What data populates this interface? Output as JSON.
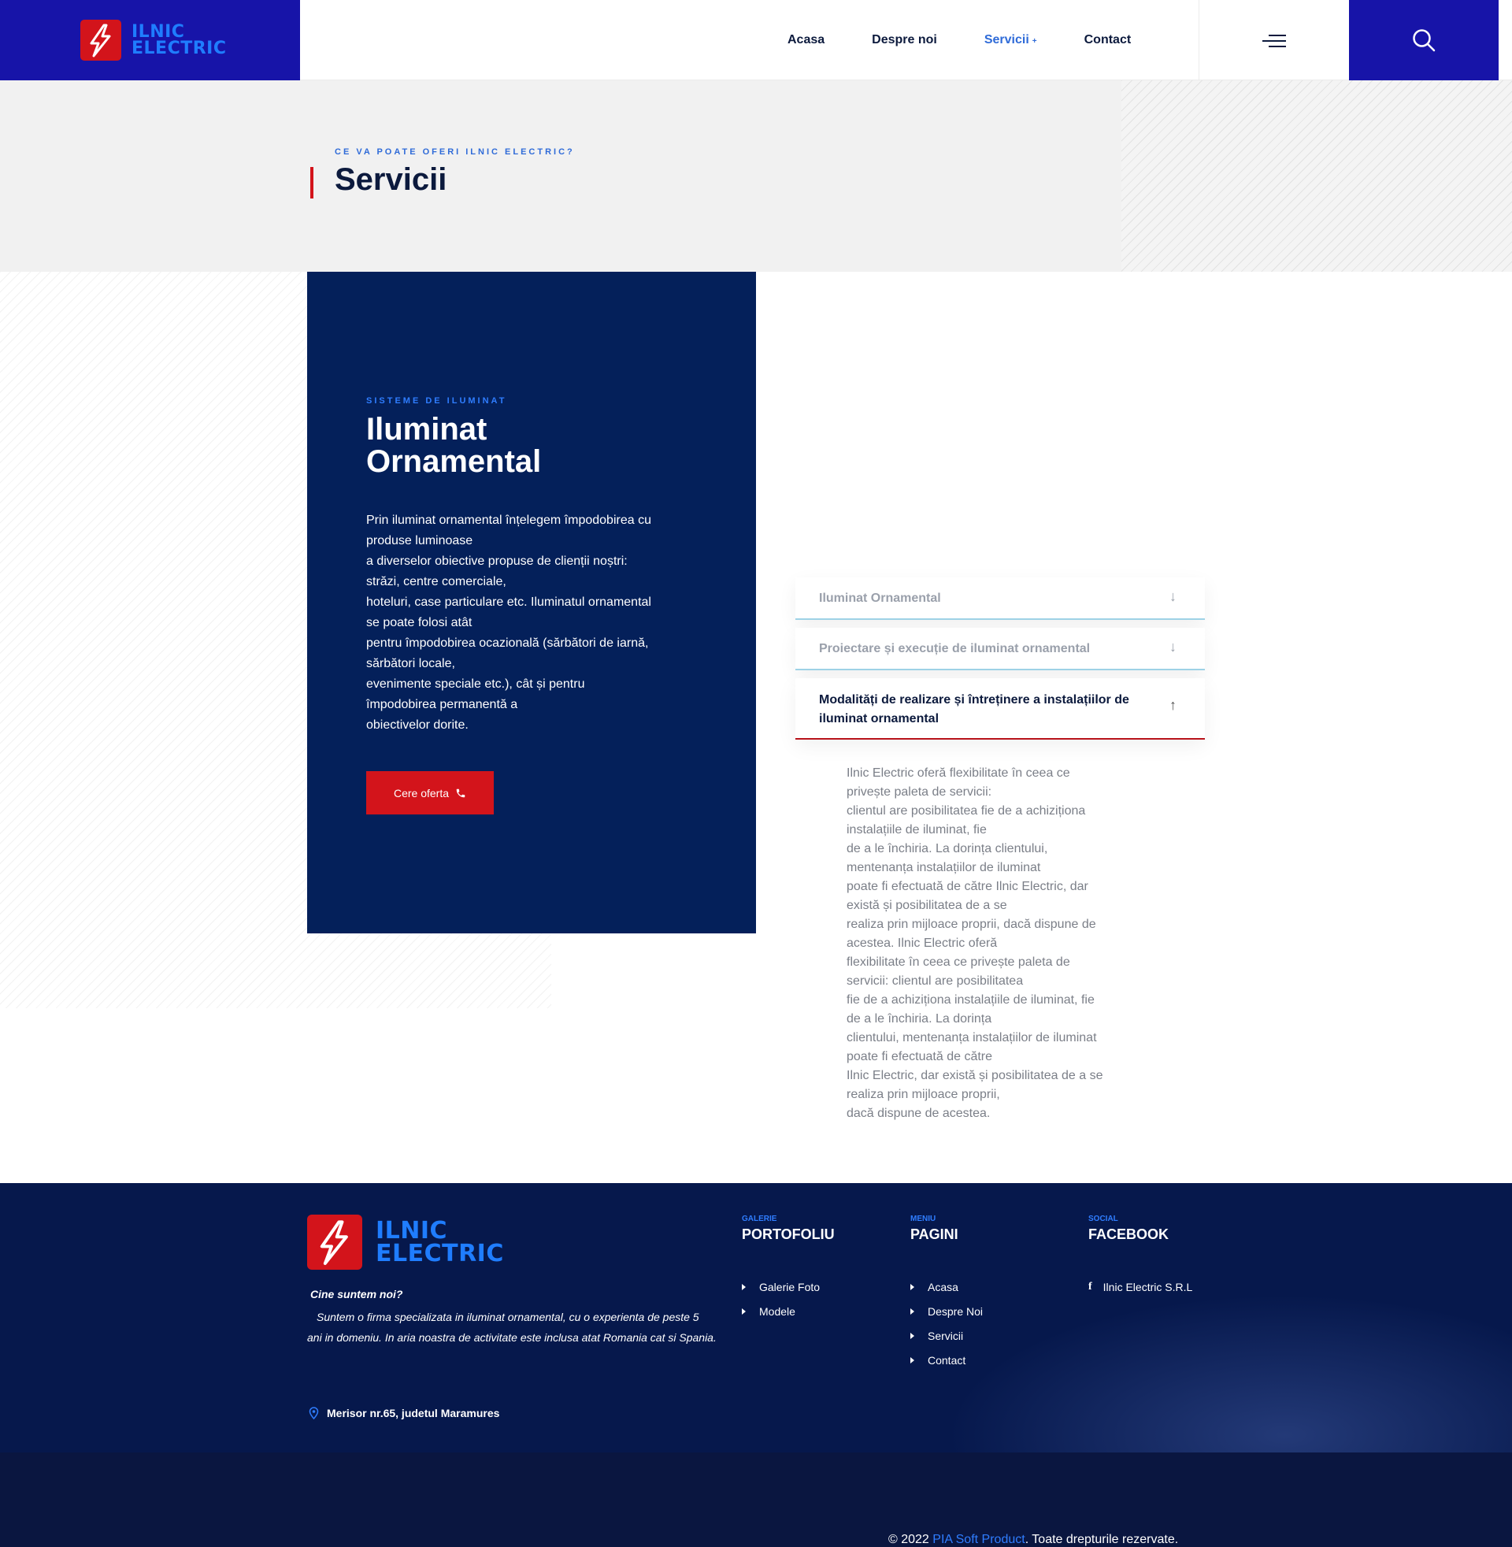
{
  "header": {
    "logo_line1": "ILNIC",
    "logo_line2": "ELECTRIC",
    "nav": [
      "Acasa",
      "Despre noi",
      "Servicii",
      "Contact"
    ],
    "nav_active": "Servicii"
  },
  "page_title": {
    "eyebrow": "CE VA POATE OFERI ILNIC ELECTRIC?",
    "title": "Servicii"
  },
  "feature": {
    "eyebrow": "SISTEME DE ILUMINAT",
    "title_line1": "Iluminat",
    "title_line2": "Ornamental",
    "text_lines": [
      "Prin iluminat ornamental înțelegem împodobirea cu",
      "produse luminoase",
      "a diverselor obiective propuse de clienții noștri:",
      "străzi, centre comerciale,",
      "hoteluri, case particulare etc. Iluminatul ornamental",
      "se poate folosi atât",
      "pentru împodobirea ocazională (sărbători de iarnă,",
      "sărbători locale,",
      "evenimente speciale etc.), cât și pentru",
      "împodobirea permanentă a",
      "obiectivelor dorite."
    ],
    "cta_label": "Cere oferta"
  },
  "accordion": {
    "items": [
      {
        "label": "Iluminat Ornamental",
        "open": false
      },
      {
        "label": "Proiectare și execuție de iluminat ornamental",
        "open": false
      },
      {
        "label": "Modalități de realizare și întreținere a instalațiilor de iluminat ornamental",
        "open": true
      }
    ],
    "open_body_lines": [
      "Ilnic Electric oferă flexibilitate în ceea ce",
      "privește paleta de servicii:",
      "clientul are posibilitatea fie de a achiziționa",
      "instalațiile de iluminat, fie",
      "de a le închiria. La dorința clientului,",
      "mentenanța instalațiilor de iluminat",
      "poate fi efectuată de către Ilnic Electric, dar",
      "există și posibilitatea de a se",
      "realiza prin mijloace proprii, dacă dispune de",
      "acestea. Ilnic Electric oferă",
      "flexibilitate în ceea ce privește paleta de",
      "servicii: clientul are posibilitatea",
      "fie de a achiziționa instalațiile de iluminat, fie",
      "de a le închiria. La dorința",
      "clientului, mentenanța instalațiilor de iluminat",
      "poate fi efectuată de către",
      "Ilnic Electric, dar există și posibilitatea de a se",
      "realiza prin mijloace proprii,",
      "dacă dispune de acestea."
    ]
  },
  "footer": {
    "logo_line1": "ILNIC",
    "logo_line2": "ELECTRIC",
    "about_title": "Cine suntem noi?",
    "about_text": "Suntem o firma specializata in iluminat ornamental, cu o experienta de peste 5 ani in domeniu. In aria noastra de activitate este inclusa atat Romania cat si Spania.",
    "address": "Merisor nr.65, judetul Maramures",
    "columns": [
      {
        "eyebrow": "GALERIE",
        "title": "PORTOFOLIU",
        "links": [
          "Galerie Foto",
          "Modele"
        ]
      },
      {
        "eyebrow": "MENIU",
        "title": "PAGINI",
        "links": [
          "Acasa",
          "Despre Noi",
          "Servicii",
          "Contact"
        ]
      },
      {
        "eyebrow": "SOCIAL",
        "title": "FACEBOOK",
        "links": [
          "Ilnic Electric S.R.L"
        ]
      }
    ],
    "copyright_prefix": "© 2022",
    "copyright_brand": "PIA Soft Product",
    "copyright_suffix": ". Toate drepturile rezervate."
  },
  "colors": {
    "brand_blue": "#1714a8",
    "navy": "#04205a",
    "accent_red": "#d3141b",
    "link_blue": "#2f6bd8"
  },
  "icons": [
    "lightning-logo-icon",
    "hamburger-menu-icon",
    "search-icon",
    "phone-icon",
    "arrow-down-icon",
    "arrow-up-icon",
    "location-pin-icon",
    "facebook-icon"
  ]
}
